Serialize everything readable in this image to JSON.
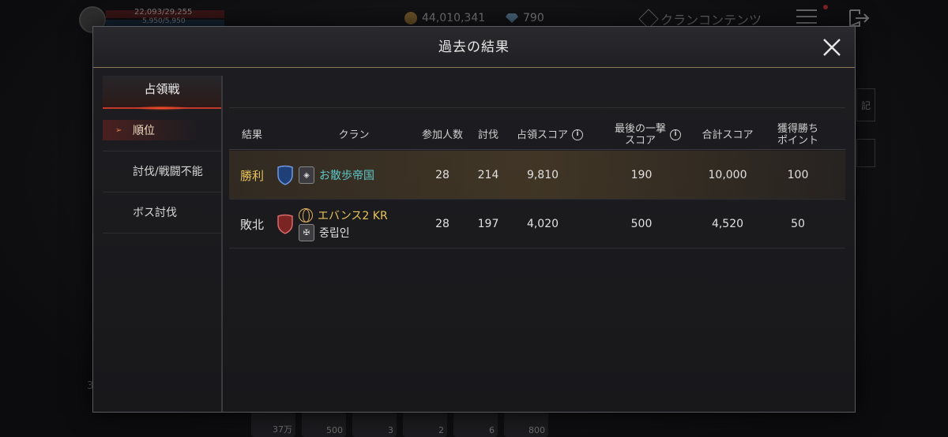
{
  "hud": {
    "hp": "22,093/29,255",
    "mp": "5,950/5,950",
    "gold": "44,010,341",
    "gems": "790",
    "clan_content": "クランコンテンツ",
    "side_label": "記",
    "left_number": "3",
    "bottom_slots": [
      "37万",
      "500",
      "3",
      "2",
      "6",
      "800"
    ]
  },
  "modal": {
    "title": "過去の結果",
    "close_icon": "close-icon"
  },
  "sidebar": {
    "tab": "占領戦",
    "items": [
      {
        "label": "順位",
        "active": true
      },
      {
        "label": "討伐/戦闘不能",
        "active": false
      },
      {
        "label": "ボス討伐",
        "active": false
      }
    ]
  },
  "table": {
    "headers": {
      "result": "結果",
      "clan": "クラン",
      "participants": "参加人数",
      "kills": "討伐",
      "occupation_score": "占領スコア",
      "last_hit_score_line1": "最後の一撃",
      "last_hit_score_line2": "スコア",
      "total_score": "合計スコア",
      "win_points_line1": "獲得勝ち",
      "win_points_line2": "ポイント"
    },
    "rows": [
      {
        "result": "勝利",
        "clan_name": "お散歩帝国",
        "participants": "28",
        "kills": "214",
        "occupation_score": "9,810",
        "last_hit_score": "190",
        "total_score": "10,000",
        "win_points": "100"
      },
      {
        "result": "敗北",
        "server_name": "エバンス2 KR",
        "clan_name": "중립인",
        "participants": "28",
        "kills": "197",
        "occupation_score": "4,020",
        "last_hit_score": "500",
        "total_score": "4,520",
        "win_points": "50"
      }
    ]
  },
  "colors": {
    "win": "#e8c35a",
    "clan_name_win": "#5fc8c8",
    "accent_red": "#c0392b",
    "shield_blue": "#2f5fa8",
    "shield_red": "#a83a3a"
  }
}
